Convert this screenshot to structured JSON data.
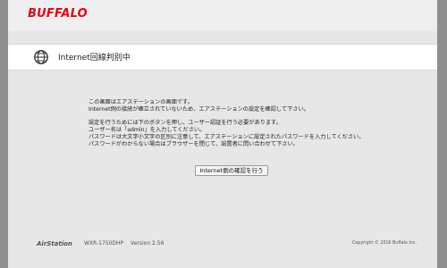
{
  "brand": {
    "logo": "BUFFALO",
    "color": "#e60012"
  },
  "status": {
    "icon": "globe-icon",
    "title": "Internet回線判別中"
  },
  "message": {
    "paragraph1": [
      "この画面はエアステーションの画面です。",
      "Internet側の接続が確立されていないため、エアステーションの設定を確認して下さい。"
    ],
    "paragraph2": [
      "設定を行うためには下のボタンを押し、ユーザー認証を行う必要があります。",
      "ユーザー名は「admin」を入力してください。",
      "パスワードは大文字小文字の区別に注意して、エアステーションに設定されたパスワードを入力してください。",
      "パスワードがわからない場合はブラウザーを閉じて、設置者に問い合わせて下さい。"
    ]
  },
  "action": {
    "button_label": "Internet側の確認を行う"
  },
  "footer": {
    "product": "AirStation",
    "model": "WXR-1750DHP",
    "version": "Version 2.56",
    "copyright": "Copyright © 2016 Buffalo Inc."
  }
}
